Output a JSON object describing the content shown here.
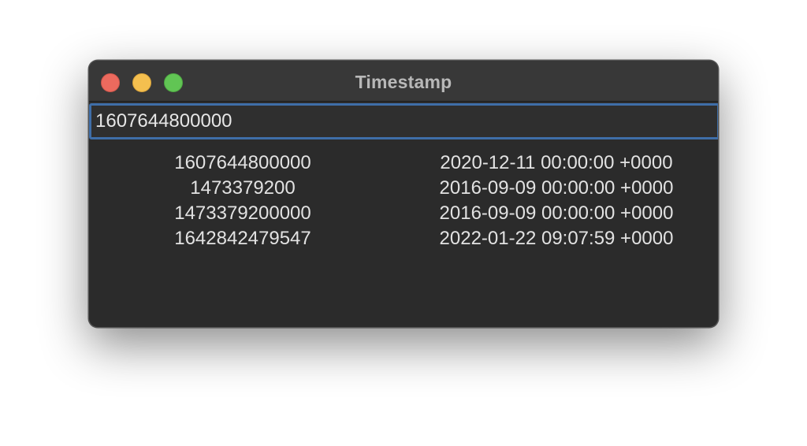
{
  "window": {
    "title": "Timestamp"
  },
  "input": {
    "value": "1607644800000"
  },
  "results": [
    {
      "timestamp": "1607644800000",
      "date": "2020-12-11 00:00:00 +0000"
    },
    {
      "timestamp": "1473379200",
      "date": "2016-09-09 00:00:00 +0000"
    },
    {
      "timestamp": "1473379200000",
      "date": "2016-09-09 00:00:00 +0000"
    },
    {
      "timestamp": "1642842479547",
      "date": "2022-01-22 09:07:59 +0000"
    }
  ],
  "colors": {
    "window_bg": "#2b2b2b",
    "titlebar_bg": "#383838",
    "focus_ring": "#3f6ea8",
    "close": "#ec6a5e",
    "minimize": "#f4bf4f",
    "maximize": "#61c554"
  }
}
